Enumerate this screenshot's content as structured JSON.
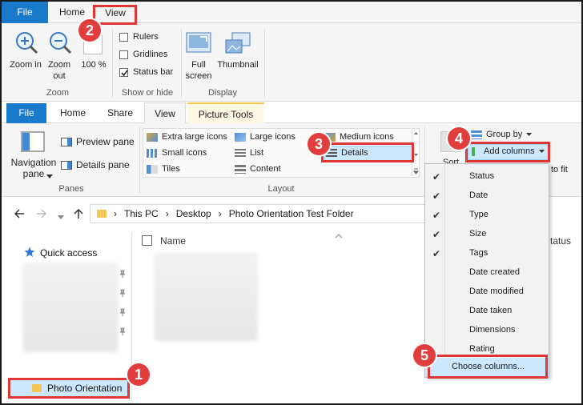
{
  "top_ribbon": {
    "tabs": [
      "File",
      "Home",
      "View"
    ],
    "zoom_in": "Zoom in",
    "zoom_out": "Zoom out",
    "zoom_pct": "100 %",
    "zoom_group": "Zoom",
    "rulers": "Rulers",
    "gridlines": "Gridlines",
    "status_bar": "Status bar",
    "showhide_group": "Show or hide",
    "full_screen": "Full screen",
    "thumbnail": "Thumbnail",
    "display_group": "Display"
  },
  "explorer_ribbon": {
    "tabs": [
      "File",
      "Home",
      "Share",
      "View",
      "Picture Tools"
    ],
    "navigation_pane": "Navigation pane",
    "preview_pane": "Preview pane",
    "details_pane": "Details pane",
    "panes_group": "Panes",
    "layout": {
      "extra_large": "Extra large icons",
      "large": "Large icons",
      "medium": "Medium icons",
      "small": "Small icons",
      "list": "List",
      "details": "Details",
      "tiles": "Tiles",
      "content": "Content"
    },
    "layout_group": "Layout",
    "group_by": "Group by",
    "add_columns": "Add columns",
    "sort": "Sort",
    "fit": "to fit"
  },
  "address": {
    "crumbs": [
      "This PC",
      "Desktop",
      "Photo Orientation Test Folder"
    ]
  },
  "nav": {
    "quick_access": "Quick access",
    "photo_orientation": "Photo Orientation"
  },
  "content": {
    "name_header": "Name",
    "status_header": "tatus"
  },
  "menu": {
    "items": [
      {
        "label": "Status",
        "checked": true
      },
      {
        "label": "Date",
        "checked": true
      },
      {
        "label": "Type",
        "checked": true
      },
      {
        "label": "Size",
        "checked": true
      },
      {
        "label": "Tags",
        "checked": true
      },
      {
        "label": "Date created",
        "checked": false
      },
      {
        "label": "Date modified",
        "checked": false
      },
      {
        "label": "Date taken",
        "checked": false
      },
      {
        "label": "Dimensions",
        "checked": false
      },
      {
        "label": "Rating",
        "checked": false
      }
    ],
    "choose_columns": "Choose columns..."
  },
  "badges": [
    "1",
    "2",
    "3",
    "4",
    "5"
  ],
  "colors": {
    "accent": "#1979ca",
    "highlight": "#e03535",
    "selection": "#cce8ff"
  }
}
